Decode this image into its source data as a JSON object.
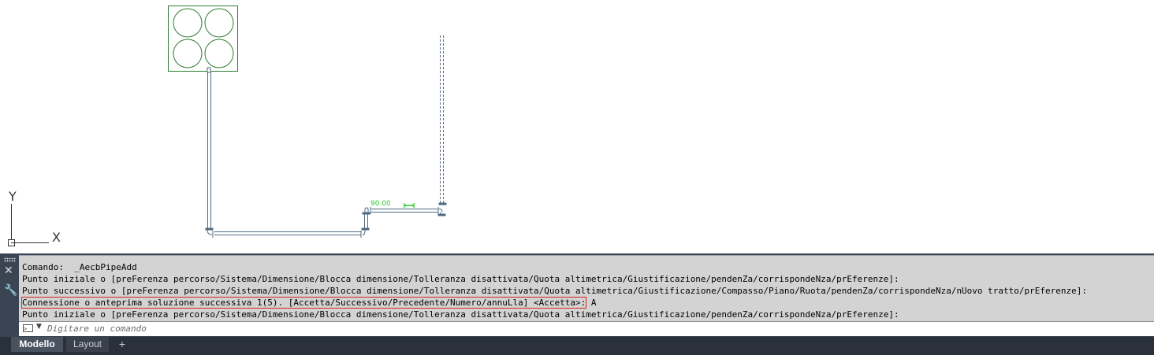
{
  "canvas": {
    "ucs_x_label": "X",
    "ucs_y_label": "Y",
    "dimension_text": "90.00",
    "colors": {
      "pipe": "#4e6a82",
      "equipment": "#2e7d32",
      "dimension": "#2dcb2d"
    }
  },
  "command_line": {
    "history": [
      "Comando:  _AecbPipeAdd",
      "Punto iniziale o [preFerenza percorso/Sistema/Dimensione/Blocca dimensione/Tolleranza disattivata/Quota altimetrica/Giustificazione/pendenZa/corrispondeNza/prEferenze]:",
      "Punto successivo o [preFerenza percorso/Sistema/Dimensione/Blocca dimensione/Tolleranza disattivata/Quota altimetrica/Giustificazione/Compasso/Piano/Ruota/pendenZa/corrispondeNza/nUovo tratto/prEferenze]:",
      "Connessione o anteprima soluzione successiva 1(5). [Accetta/Successivo/Precedente/Numero/annuLla] <Accetta>:",
      "Punto iniziale o [preFerenza percorso/Sistema/Dimensione/Blocca dimensione/Tolleranza disattivata/Quota altimetrica/Giustificazione/pendenZa/corrispondeNza/prEferenze]:"
    ],
    "highlighted_answer": " A",
    "input_placeholder": "Digitare un comando",
    "input_value": "",
    "highlight_color": "#d9241c",
    "icons": {
      "close": "close-icon",
      "customize": "wrench-icon",
      "grip": "grip-icon",
      "prompt": "command-prompt-icon"
    }
  },
  "tabs": [
    {
      "label": "Modello",
      "active": true
    },
    {
      "label": "Layout",
      "active": false
    }
  ],
  "add_tab_label": "+"
}
